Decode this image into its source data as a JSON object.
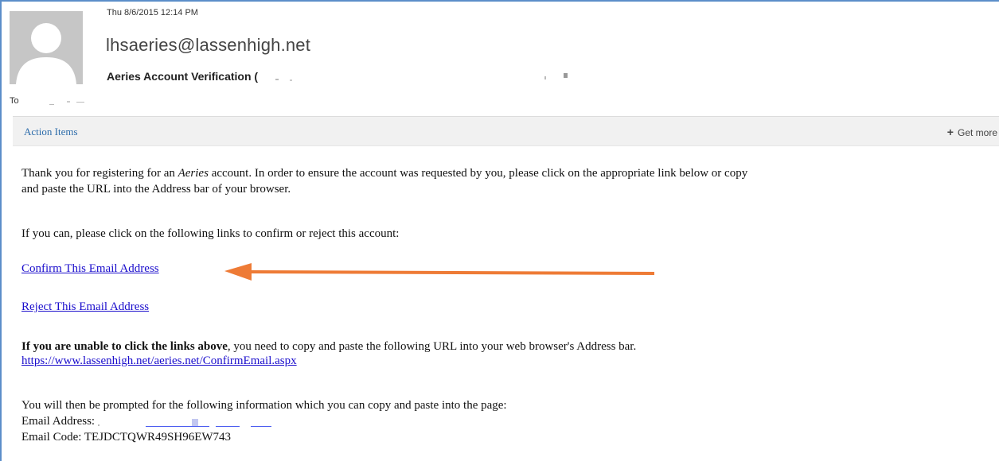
{
  "header": {
    "date": "Thu 8/6/2015 12:14 PM",
    "sender": "lhsaeries@lassenhigh.net",
    "subject_prefix": "Aeries Account Verification (",
    "to_label": "To"
  },
  "action_bar": {
    "action_items_label": "Action Items",
    "get_more_label": "Get more"
  },
  "body": {
    "para1_line1_before": "Thank you for registering for an ",
    "para1_line1_em": "Aeries",
    "para1_line1_after": " account. In order to ensure the account was requested by you, please click on the appropriate link below or copy",
    "para1_line2": "and paste the URL into the Address bar of your browser.",
    "para2": "If you can, please click on the following links to confirm or reject this account:",
    "confirm_link": "Confirm This Email Address",
    "reject_link": "Reject This Email Address",
    "para3_bold": "If you are unable to click the links above",
    "para3_rest": ", you need to copy and paste the following URL into your web browser's Address bar.",
    "url": "https://www.lassenhigh.net/aeries.net/ConfirmEmail.aspx",
    "para4": "You will then be prompted for the following information which you can copy and paste into the page:",
    "email_label": "Email Address: ",
    "code_label": "Email Code: ",
    "code_value": "TEJDCTQWR49SH96EW743"
  },
  "colors": {
    "link": "#1a0dcc",
    "accent_blue": "#2e6dab",
    "arrow": "#ee7b36",
    "frame": "#5b8ec9"
  },
  "icons": {
    "avatar": "person-silhouette",
    "get_more": "plus-icon",
    "annotation": "orange-arrow-icon"
  }
}
